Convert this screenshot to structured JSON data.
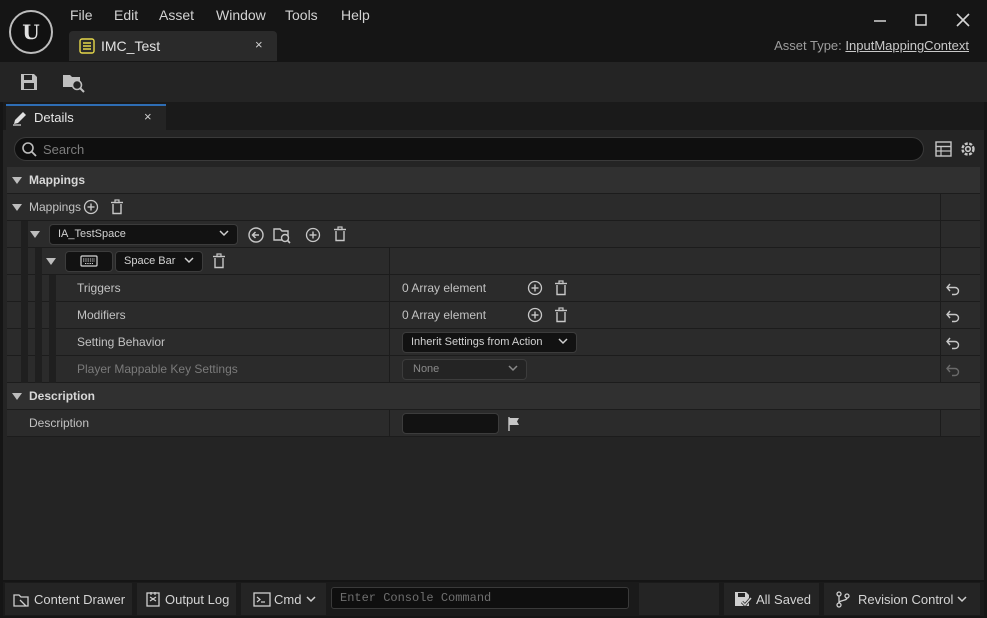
{
  "menu": [
    "File",
    "Edit",
    "Asset",
    "Window",
    "Tools",
    "Help"
  ],
  "logo_text": "U",
  "document_tab": {
    "label": "IMC_Test",
    "close": "×"
  },
  "asset_type": {
    "label": "Asset Type:",
    "value": "InputMappingContext"
  },
  "details_tab": {
    "label": "Details",
    "close": "×"
  },
  "search": {
    "placeholder": "Search"
  },
  "sections": {
    "mappings_category": "Mappings",
    "mappings_array": "Mappings",
    "input_action": "IA_TestSpace",
    "key": "Space Bar",
    "triggers": {
      "label": "Triggers",
      "value": "0 Array element"
    },
    "modifiers": {
      "label": "Modifiers",
      "value": "0 Array element"
    },
    "setting_behavior": {
      "label": "Setting Behavior",
      "value": "Inherit Settings from Action"
    },
    "player_mappable": {
      "label": "Player Mappable Key Settings",
      "value": "None"
    },
    "description_category": "Description",
    "description_field": {
      "label": "Description",
      "value": ""
    }
  },
  "statusbar": {
    "content_drawer": "Content Drawer",
    "output_log": "Output Log",
    "cmd": "Cmd",
    "console_placeholder": "Enter Console Command",
    "all_saved": "All Saved",
    "revision_control": "Revision Control"
  },
  "colors": {
    "accent": "#2e6db4",
    "background": "#151515",
    "panel": "#242424",
    "row": "#2b2b2b"
  }
}
